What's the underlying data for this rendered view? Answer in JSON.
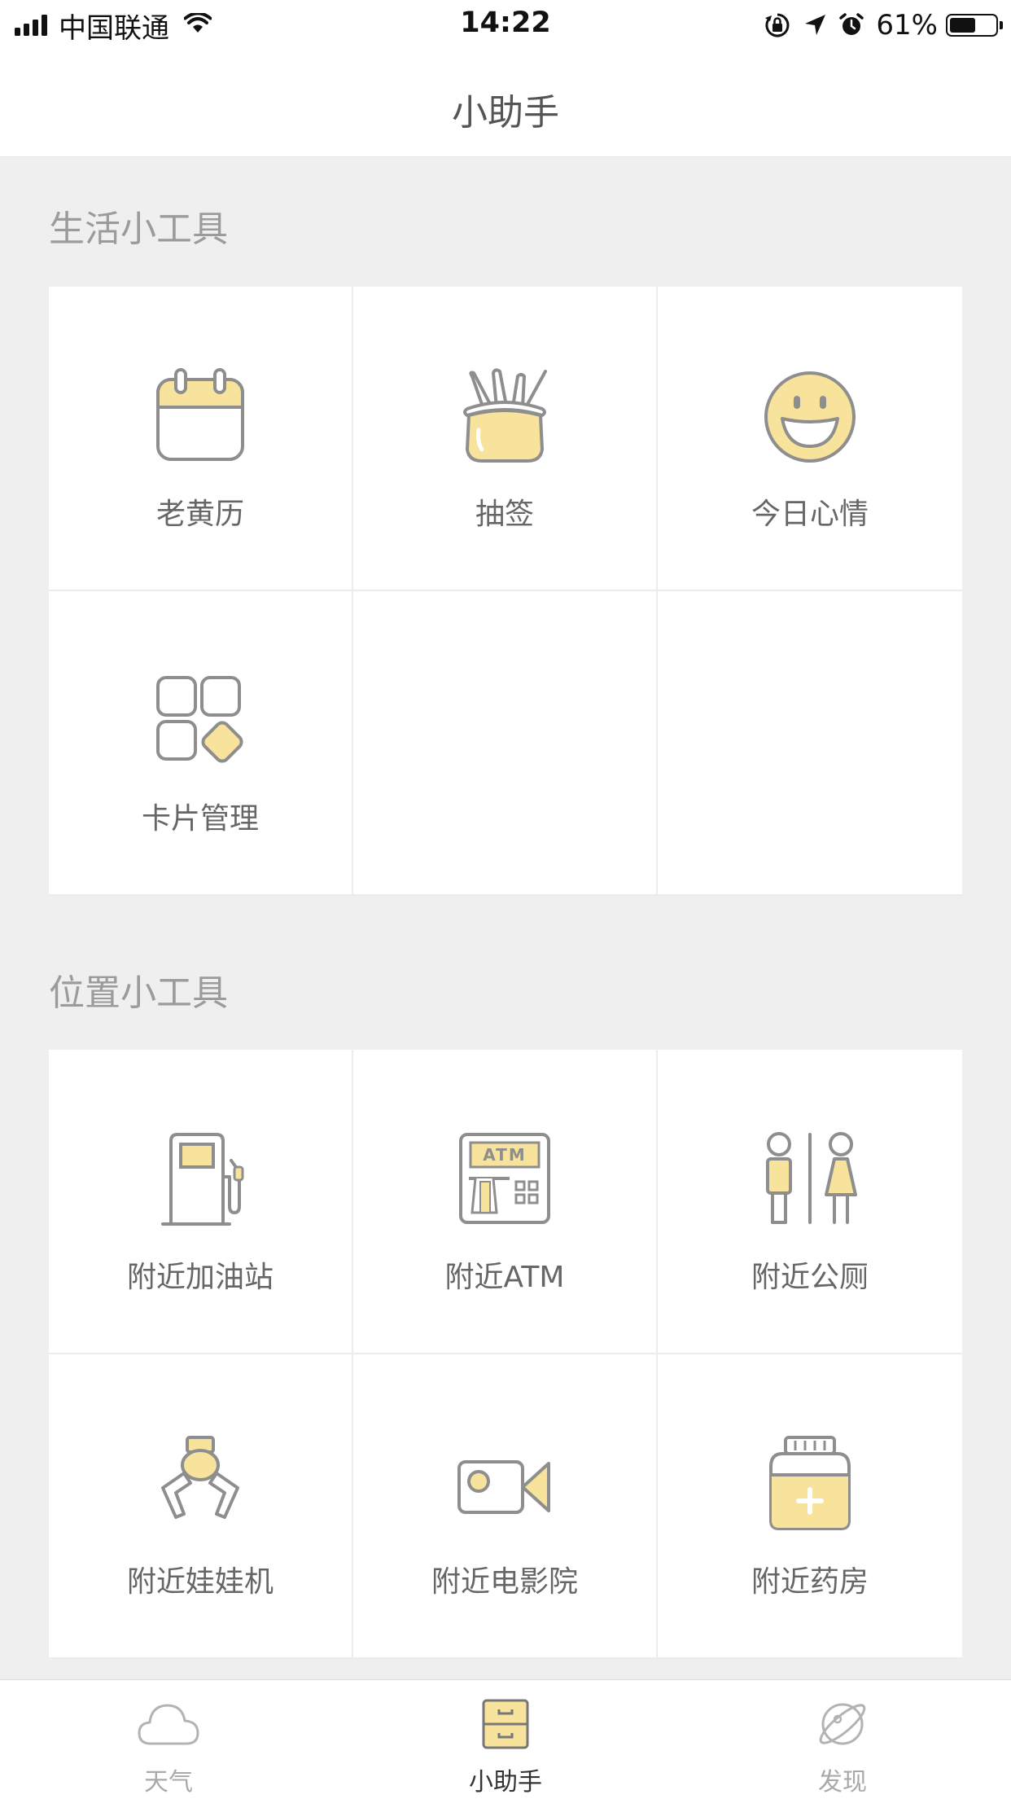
{
  "status_bar": {
    "carrier": "中国联通",
    "time": "14:22",
    "battery_percent": "61%",
    "battery_level": 0.61,
    "signal_bars": 4,
    "icons": [
      "wifi-icon",
      "orientation-lock-icon",
      "location-arrow-icon",
      "alarm-icon",
      "battery-icon"
    ]
  },
  "nav": {
    "title": "小助手"
  },
  "sections": [
    {
      "title": "生活小工具",
      "items": [
        {
          "label": "老黄历",
          "icon": "calendar-icon"
        },
        {
          "label": "抽签",
          "icon": "fortune-sticks-icon"
        },
        {
          "label": "今日心情",
          "icon": "smiley-face-icon"
        },
        {
          "label": "卡片管理",
          "icon": "card-grid-icon"
        }
      ]
    },
    {
      "title": "位置小工具",
      "items": [
        {
          "label": "附近加油站",
          "icon": "gas-pump-icon"
        },
        {
          "label": "附近ATM",
          "icon": "atm-icon"
        },
        {
          "label": "附近公厕",
          "icon": "restroom-icon"
        },
        {
          "label": "附近娃娃机",
          "icon": "claw-machine-icon"
        },
        {
          "label": "附近电影院",
          "icon": "movie-camera-icon"
        },
        {
          "label": "附近药房",
          "icon": "medicine-bottle-icon"
        }
      ]
    }
  ],
  "tabs": [
    {
      "label": "天气",
      "icon": "cloud-icon",
      "active": false
    },
    {
      "label": "小助手",
      "icon": "drawer-icon",
      "active": true
    },
    {
      "label": "发现",
      "icon": "planet-icon",
      "active": false
    }
  ],
  "colors": {
    "accent_yellow": "#f8e39c",
    "icon_stroke": "#8e8e8e",
    "page_background": "#efefef",
    "card_background": "#ffffff"
  }
}
